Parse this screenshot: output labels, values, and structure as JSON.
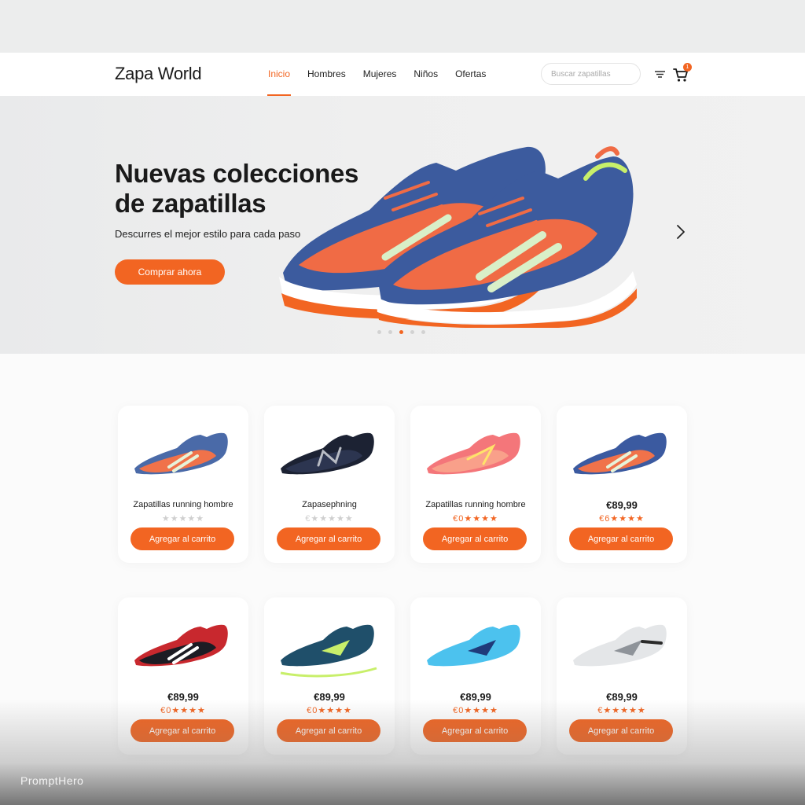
{
  "brand": {
    "name": "Zapa World"
  },
  "nav": {
    "items": [
      {
        "label": "Inicio",
        "active": true
      },
      {
        "label": "Hombres",
        "active": false
      },
      {
        "label": "Mujeres",
        "active": false
      },
      {
        "label": "Niños",
        "active": false
      },
      {
        "label": "Ofertas",
        "active": false
      }
    ]
  },
  "search": {
    "placeholder": "Buscar zapatillas",
    "value": ""
  },
  "header_icons": {
    "menu": "filter-lines-icon",
    "cart": "cart-icon",
    "cart_badge": "1"
  },
  "hero": {
    "title": "Nuevas colecciones de zapatillas",
    "subtitle": "Descurres el mejor estilo para cada paso",
    "button_label": "Comprar ahora",
    "slides_total": 5,
    "active_slide": 3
  },
  "products": [
    {
      "name": "Zapatillas running hombre",
      "price": "",
      "rating": "★★★★★",
      "button_label": "Agregar al carrito",
      "colors": [
        "#4a6aa8",
        "#f0724a",
        "#ffffff"
      ]
    },
    {
      "name": "Zapasephning",
      "price": "",
      "rating": "€★★★★★",
      "button_label": "Agregar al carrito",
      "colors": [
        "#1c2233",
        "#2c3550",
        "#ffffff"
      ]
    },
    {
      "name": "Zapatillas running hombre",
      "price": "",
      "rating": "€0★★★★",
      "button_label": "Agregar al carrito",
      "colors": [
        "#f4767a",
        "#f9a08a",
        "#ffffff"
      ]
    },
    {
      "name": "",
      "price": "€89,99",
      "rating": "€6★★★★",
      "button_label": "Agregar al carrito",
      "colors": [
        "#3b5aa0",
        "#f0724a",
        "#ffffff"
      ]
    },
    {
      "name": "",
      "price": "€89,99",
      "rating": "€0★★★★",
      "button_label": "Agregar al carrito",
      "colors": [
        "#c8282e",
        "#1c1c24",
        "#ffffff"
      ]
    },
    {
      "name": "",
      "price": "€89,99",
      "rating": "€0★★★★",
      "button_label": "Agregar al carrito",
      "colors": [
        "#1f4f6a",
        "#c8ef6a",
        "#ffffff"
      ]
    },
    {
      "name": "",
      "price": "€89,99",
      "rating": "€0★★★★",
      "button_label": "Agregar al carrito",
      "colors": [
        "#4cc2ee",
        "#1f3a7a",
        "#ffffff"
      ]
    },
    {
      "name": "",
      "price": "€89,99",
      "rating": "€★★★★★",
      "button_label": "Agregar al carrito",
      "colors": [
        "#e4e6e8",
        "#8e9399",
        "#ffffff"
      ]
    }
  ],
  "accent_color": "#f26522",
  "watermark": "PromptHero"
}
